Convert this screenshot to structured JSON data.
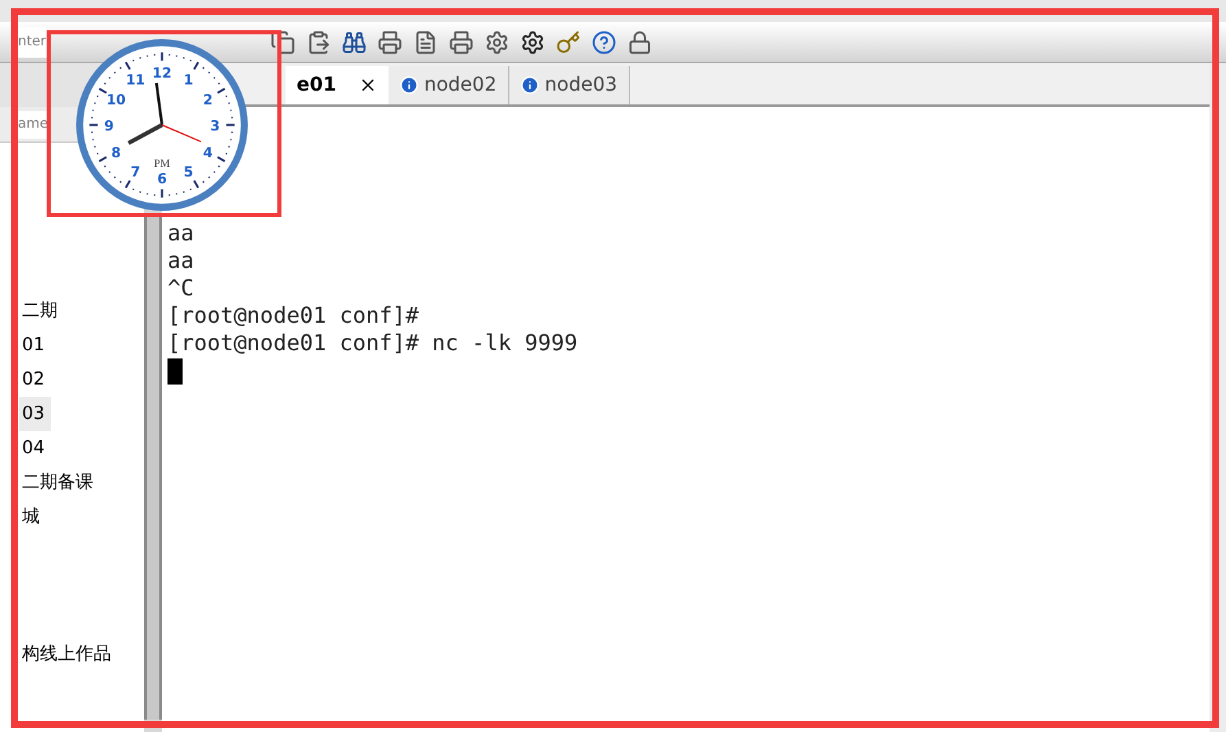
{
  "toolbar": {
    "host_field": {
      "placeholder": "nter"
    }
  },
  "tabs": [
    {
      "label": "e01",
      "selected": true
    },
    {
      "label": "node02",
      "selected": false
    },
    {
      "label": "node03",
      "selected": false
    }
  ],
  "sidebar": {
    "name_field": {
      "placeholder": "ame"
    },
    "items": [
      {
        "label": "二期",
        "selected": false
      },
      {
        "label": "01",
        "selected": false
      },
      {
        "label": "02",
        "selected": false
      },
      {
        "label": "03",
        "selected": true
      },
      {
        "label": "04",
        "selected": false
      },
      {
        "label": "二期备课",
        "selected": false
      },
      {
        "label": "城",
        "selected": false
      },
      {
        "label": "构线上作品",
        "selected": false
      }
    ]
  },
  "terminal": {
    "lines": [
      "aa",
      "aa",
      "^C",
      "[root@node01 conf]#",
      "[root@node01 conf]# nc -lk 9999"
    ]
  },
  "clock": {
    "numerals": [
      "12",
      "1",
      "2",
      "3",
      "4",
      "5",
      "6",
      "7",
      "8",
      "9",
      "10",
      "11"
    ],
    "period": "PM"
  }
}
